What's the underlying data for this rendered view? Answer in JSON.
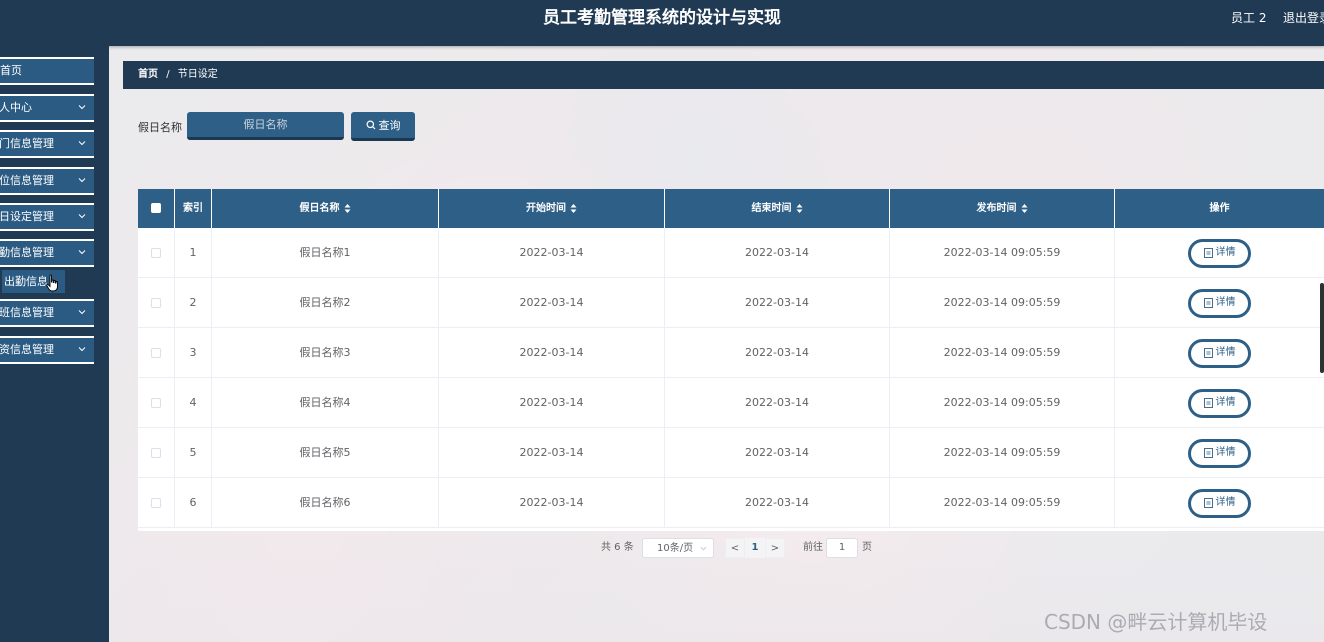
{
  "app": {
    "title": "员工考勤管理系统的设计与实现",
    "user": "员工 2",
    "logout": "退出登录"
  },
  "sidebar": {
    "home": "首页",
    "items": [
      {
        "label": "个人中心"
      },
      {
        "label": "部门信息管理"
      },
      {
        "label": "岗位信息管理"
      },
      {
        "label": "节日设定管理"
      },
      {
        "label": "考勤信息管理"
      },
      {
        "label": "加班信息管理"
      },
      {
        "label": "工资信息管理"
      }
    ],
    "submenu_active": "出勤信息"
  },
  "breadcrumb": {
    "home": "首页",
    "separator": "/",
    "current": "节日设定"
  },
  "search": {
    "label": "假日名称",
    "placeholder": "假日名称",
    "button": "查询"
  },
  "table": {
    "headers": {
      "index": "索引",
      "name": "假日名称",
      "start": "开始时间",
      "end": "结束时间",
      "published": "发布时间",
      "action": "操作"
    },
    "rows": [
      {
        "index": "1",
        "name": "假日名称1",
        "start": "2022-03-14",
        "end": "2022-03-14",
        "published": "2022-03-14 09:05:59",
        "action": "详情"
      },
      {
        "index": "2",
        "name": "假日名称2",
        "start": "2022-03-14",
        "end": "2022-03-14",
        "published": "2022-03-14 09:05:59",
        "action": "详情"
      },
      {
        "index": "3",
        "name": "假日名称3",
        "start": "2022-03-14",
        "end": "2022-03-14",
        "published": "2022-03-14 09:05:59",
        "action": "详情"
      },
      {
        "index": "4",
        "name": "假日名称4",
        "start": "2022-03-14",
        "end": "2022-03-14",
        "published": "2022-03-14 09:05:59",
        "action": "详情"
      },
      {
        "index": "5",
        "name": "假日名称5",
        "start": "2022-03-14",
        "end": "2022-03-14",
        "published": "2022-03-14 09:05:59",
        "action": "详情"
      },
      {
        "index": "6",
        "name": "假日名称6",
        "start": "2022-03-14",
        "end": "2022-03-14",
        "published": "2022-03-14 09:05:59",
        "action": "详情"
      }
    ]
  },
  "pagination": {
    "total": "共 6 条",
    "page_size": "10条/页",
    "prev": "<",
    "current": "1",
    "next": ">",
    "goto_label": "前往",
    "goto_value": "1",
    "page_unit": "页"
  },
  "watermark": "CSDN @畔云计算机毕设",
  "colors": {
    "primary": "#2e5f86",
    "dark": "#203a53"
  }
}
